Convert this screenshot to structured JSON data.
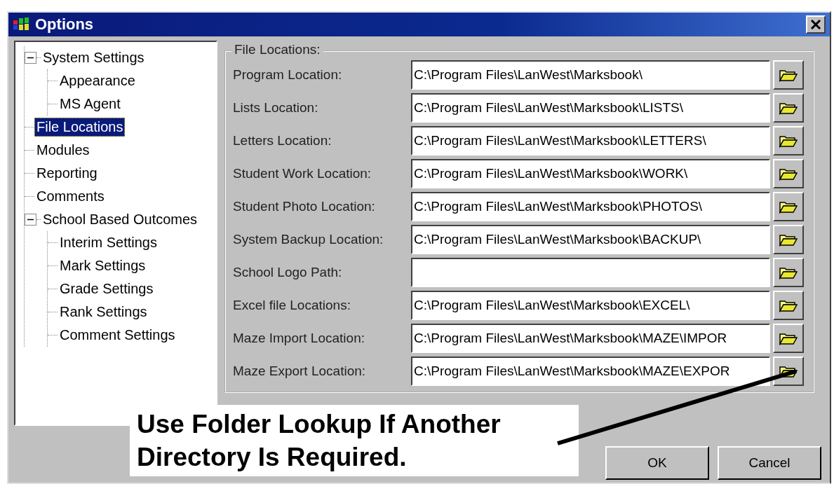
{
  "window": {
    "title": "Options"
  },
  "tree": [
    {
      "label": "System Settings",
      "selected": false,
      "expanded": true,
      "children": [
        {
          "label": "Appearance",
          "selected": false
        },
        {
          "label": "MS Agent",
          "selected": false
        }
      ]
    },
    {
      "label": "File Locations",
      "selected": true
    },
    {
      "label": "Modules",
      "selected": false
    },
    {
      "label": "Reporting",
      "selected": false
    },
    {
      "label": "Comments",
      "selected": false
    },
    {
      "label": "School Based Outcomes",
      "selected": false,
      "expanded": true,
      "children": [
        {
          "label": "Interim Settings",
          "selected": false
        },
        {
          "label": "Mark Settings",
          "selected": false
        },
        {
          "label": "Grade Settings",
          "selected": false
        },
        {
          "label": "Rank Settings",
          "selected": false
        },
        {
          "label": "Comment Settings",
          "selected": false
        }
      ]
    }
  ],
  "group": {
    "title": "File Locations:",
    "rows": [
      {
        "label": "Program Location:",
        "value": "C:\\Program Files\\LanWest\\Marksbook\\"
      },
      {
        "label": "Lists Location:",
        "value": "C:\\Program Files\\LanWest\\Marksbook\\LISTS\\"
      },
      {
        "label": "Letters Location:",
        "value": "C:\\Program Files\\LanWest\\Marksbook\\LETTERS\\"
      },
      {
        "label": "Student Work Location:",
        "value": "C:\\Program Files\\LanWest\\Marksbook\\WORK\\"
      },
      {
        "label": "Student Photo Location:",
        "value": "C:\\Program Files\\LanWest\\Marksbook\\PHOTOS\\"
      },
      {
        "label": "System Backup Location:",
        "value": "C:\\Program Files\\LanWest\\Marksbook\\BACKUP\\"
      },
      {
        "label": "School Logo Path:"
      },
      {
        "label": "Excel file Locations:",
        "value": "C:\\Program Files\\LanWest\\Marksbook\\EXCEL\\"
      },
      {
        "label": "Maze Import Location:",
        "value": "C:\\Program Files\\LanWest\\Marksbook\\MAZE\\IMPOR"
      },
      {
        "label": "Maze Export Location:",
        "value": "C:\\Program Files\\LanWest\\Marksbook\\MAZE\\EXPOR"
      }
    ]
  },
  "callout": {
    "text": "Use Folder Lookup If Another Directory Is Required."
  },
  "buttons": [
    "OK",
    "Cancel"
  ]
}
